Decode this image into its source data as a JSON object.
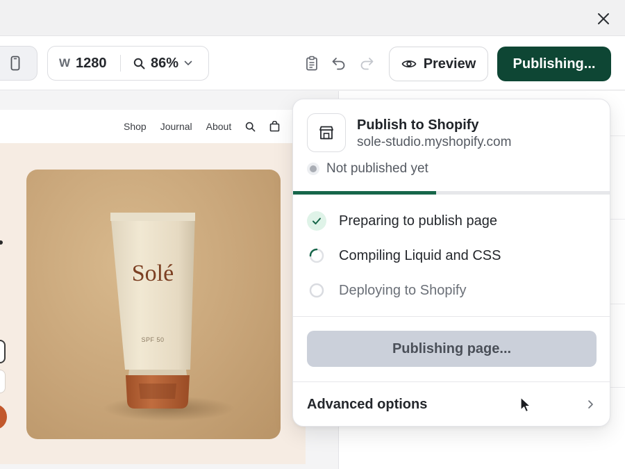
{
  "toolbar": {
    "width_label": "W",
    "width_value": "1280",
    "zoom_value": "86%",
    "preview_label": "Preview",
    "publishing_label": "Publishing..."
  },
  "site_nav": {
    "items": [
      "Shop",
      "Journal",
      "About"
    ]
  },
  "product": {
    "brand": "Solé",
    "spf": "SPF 50"
  },
  "publish_panel": {
    "title": "Publish to Shopify",
    "domain": "sole-studio.myshopify.com",
    "status": "Not published yet",
    "progress": 0.45,
    "steps": [
      {
        "label": "Preparing to publish page",
        "state": "done"
      },
      {
        "label": "Compiling Liquid and CSS",
        "state": "in-progress"
      },
      {
        "label": "Deploying to Shopify",
        "state": "pending"
      }
    ],
    "action_label": "Publishing page...",
    "advanced_label": "Advanced options"
  },
  "colors": {
    "primary": "#0e4634",
    "progress": "#17664a",
    "success_bg": "#dff3e8",
    "disabled_button": "#cbd0da",
    "bottle_cap": "#b9663a"
  },
  "icons": {
    "close": "close-icon",
    "device": "mobile-device-icon",
    "zoom": "magnifier-icon",
    "clipboard": "clipboard-icon",
    "undo": "undo-icon",
    "redo": "redo-icon",
    "preview": "eye-icon",
    "store": "store-icon",
    "done": "check-icon",
    "loading": "spinner-icon",
    "pending": "empty-circle-icon",
    "chevron": "chevron-right-icon",
    "cursor": "mouse-cursor-icon"
  }
}
